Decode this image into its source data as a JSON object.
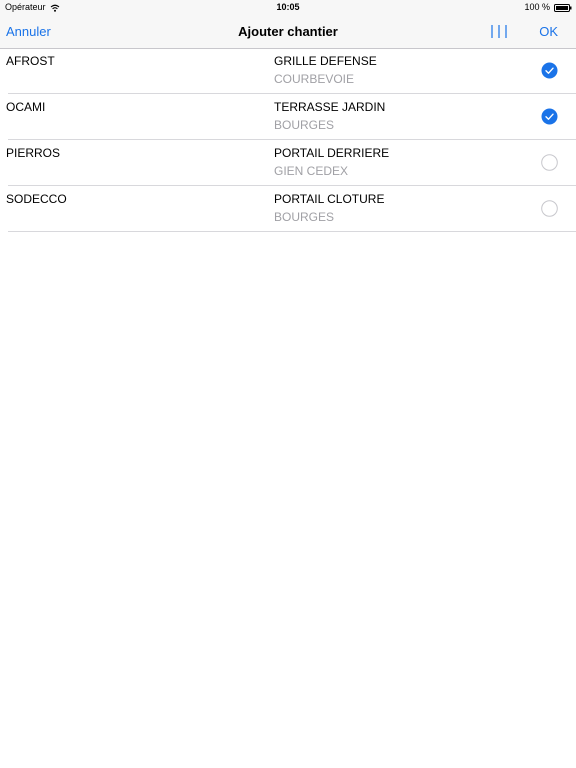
{
  "status_bar": {
    "carrier": "Opérateur",
    "time": "10:05",
    "battery": "100 %"
  },
  "nav": {
    "cancel_label": "Annuler",
    "title": "Ajouter chantier",
    "columns_icon": "columns-icon",
    "ok_label": "OK"
  },
  "colors": {
    "accent": "#1a73e8",
    "secondary_text": "#a0a0a5",
    "bar_background": "#f7f7f7"
  },
  "rows": [
    {
      "client": "AFROST",
      "site": "GRILLE DEFENSE",
      "city": "COURBEVOIE",
      "selected": true
    },
    {
      "client": "OCAMI",
      "site": "TERRASSE JARDIN",
      "city": "BOURGES",
      "selected": true
    },
    {
      "client": "PIERROS",
      "site": "PORTAIL DERRIERE",
      "city": "GIEN CEDEX",
      "selected": false
    },
    {
      "client": "SODECCO",
      "site": "PORTAIL CLOTURE",
      "city": "BOURGES",
      "selected": false
    }
  ]
}
